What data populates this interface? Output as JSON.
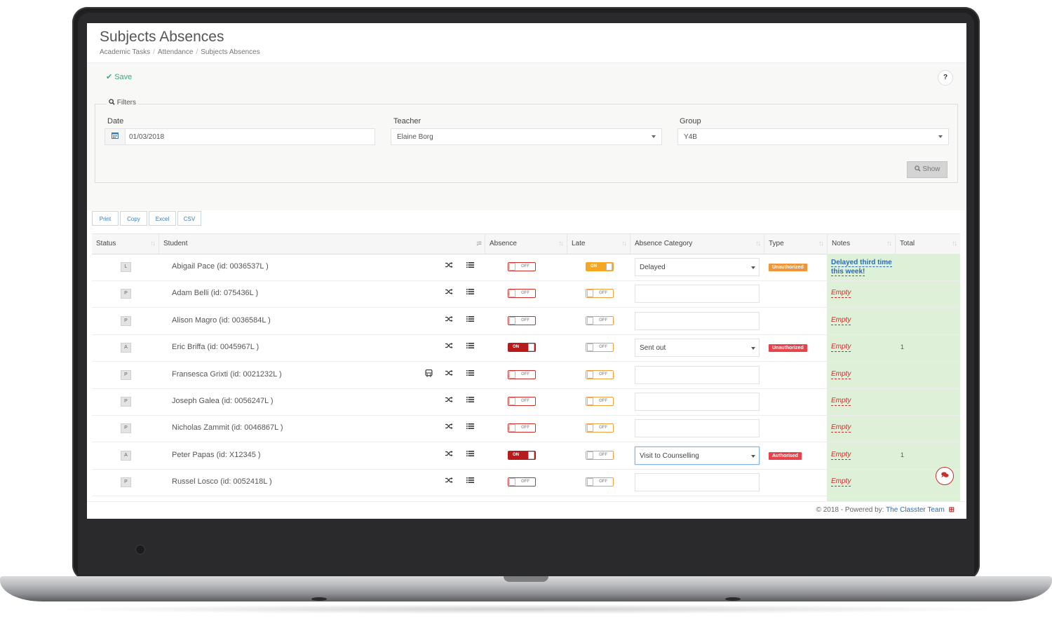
{
  "header": {
    "title": "Subjects Absences",
    "breadcrumb": [
      "Academic Tasks",
      "Attendance",
      "Subjects Absences"
    ]
  },
  "toolbar": {
    "save_label": "Save",
    "help_label": "?"
  },
  "filters": {
    "legend": "Filters",
    "date_label": "Date",
    "date_value": "01/03/2018",
    "teacher_label": "Teacher",
    "teacher_value": "Elaine Borg",
    "group_label": "Group",
    "group_value": "Y4B",
    "show_label": "Show"
  },
  "export_buttons": [
    "Print",
    "Copy",
    "Excel",
    "CSV"
  ],
  "table": {
    "columns": [
      "Status",
      "Student",
      "Absence",
      "Late",
      "Absence Category",
      "Type",
      "Notes",
      "Total"
    ],
    "rows": [
      {
        "status": "L",
        "student": "Abigail Pace (id: 0036537L )",
        "absence": "OFF",
        "late": "ON",
        "category": "Delayed",
        "type": "Unauthorized",
        "notes": "Delayed third time this week!",
        "total": "",
        "bus": false
      },
      {
        "status": "P",
        "student": "Adam Belli (id: 075436L )",
        "absence": "OFF",
        "late": "OFF",
        "category": "",
        "type": "",
        "notes": "Empty",
        "total": "",
        "bus": false
      },
      {
        "status": "P",
        "student": "Alison Magro (id: 0036584L )",
        "absence": "OFF",
        "late": "OFF",
        "category": "",
        "type": "",
        "notes": "Empty",
        "total": "",
        "bus": false
      },
      {
        "status": "A",
        "student": "Eric Briffa (id: 0045967L )",
        "absence": "ON",
        "late": "OFF",
        "category": "Sent out",
        "type": "Unauthorized",
        "notes": "Empty",
        "total": "1",
        "bus": false
      },
      {
        "status": "P",
        "student": "Fransesca Grixti (id: 0021232L )",
        "absence": "OFF",
        "late": "OFF",
        "category": "",
        "type": "",
        "notes": "Empty",
        "total": "",
        "bus": true
      },
      {
        "status": "P",
        "student": "Joseph Galea (id: 0056247L )",
        "absence": "OFF",
        "late": "OFF",
        "category": "",
        "type": "",
        "notes": "Empty",
        "total": "",
        "bus": false
      },
      {
        "status": "P",
        "student": "Nicholas Zammit (id: 0046867L )",
        "absence": "OFF",
        "late": "OFF",
        "category": "",
        "type": "",
        "notes": "Empty",
        "total": "",
        "bus": false
      },
      {
        "status": "A",
        "student": "Peter Papas (id: X12345 )",
        "absence": "ON",
        "late": "OFF",
        "category": "Visit to Counselling",
        "type": "Authorised",
        "notes": "Empty",
        "total": "1",
        "bus": false
      },
      {
        "status": "P",
        "student": "Russel Losco (id: 0052418L )",
        "absence": "OFF",
        "late": "OFF",
        "category": "",
        "type": "",
        "notes": "Empty",
        "total": "",
        "bus": false
      }
    ]
  },
  "footer": {
    "text": "© 2018 - Powered by:",
    "link": "The Classter Team"
  },
  "colors": {
    "save": "#2fae7a",
    "absence_on": "#b71c1c",
    "late_on": "#f5a623",
    "unauthorized": "#f0963a",
    "unauthorized_alt": "#e8434b",
    "authorised": "#e8434b",
    "notes_bg": "#dff0d8",
    "link": "#2a6bb3"
  },
  "icons": {
    "save": "check-icon",
    "help": "question-icon",
    "filters": "search-icon",
    "date": "calendar-icon",
    "show": "search-icon",
    "row_swap": "shuffle-icon",
    "row_list": "list-icon",
    "bus": "bus-icon",
    "chat": "chat-icon",
    "footer_logo": "classter-logo-icon"
  }
}
